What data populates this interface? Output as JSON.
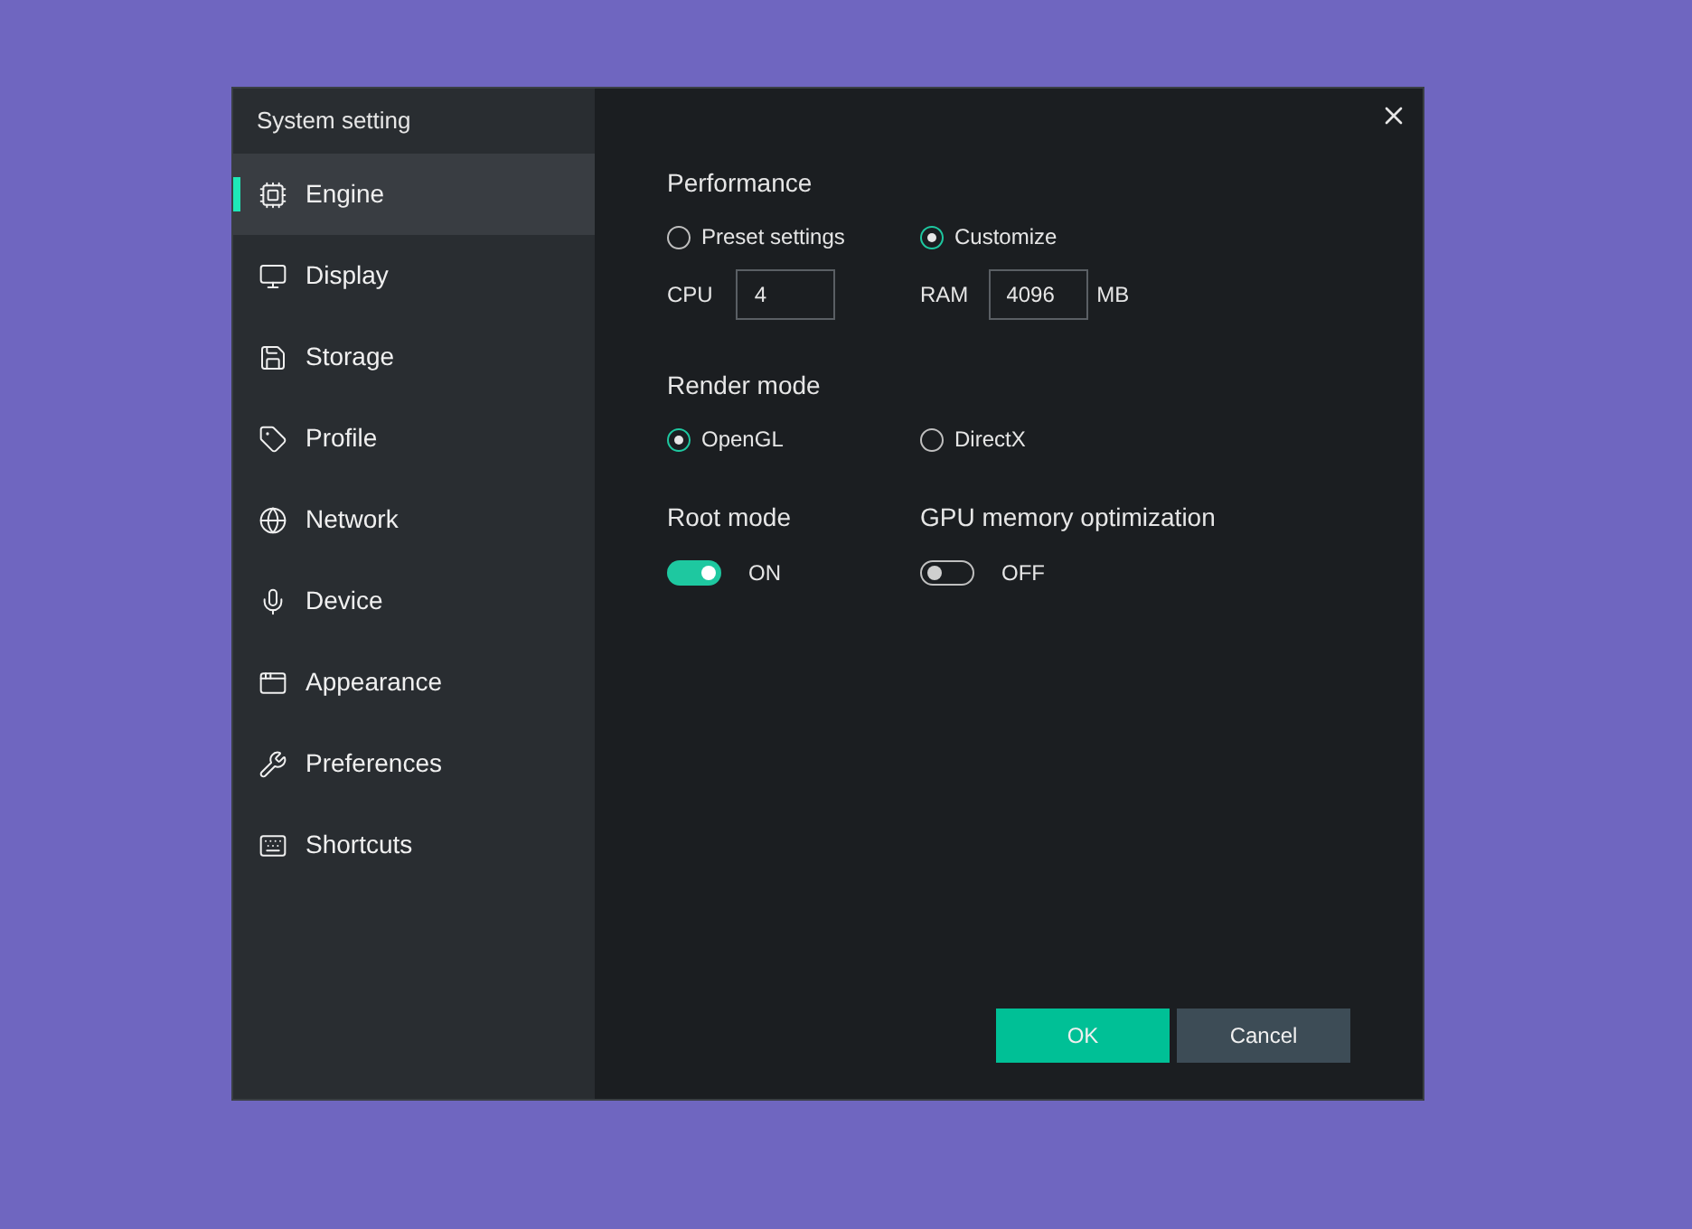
{
  "window": {
    "title": "System setting"
  },
  "sidebar": {
    "items": [
      {
        "label": "Engine",
        "selected": true
      },
      {
        "label": "Display",
        "selected": false
      },
      {
        "label": "Storage",
        "selected": false
      },
      {
        "label": "Profile",
        "selected": false
      },
      {
        "label": "Network",
        "selected": false
      },
      {
        "label": "Device",
        "selected": false
      },
      {
        "label": "Appearance",
        "selected": false
      },
      {
        "label": "Preferences",
        "selected": false
      },
      {
        "label": "Shortcuts",
        "selected": false
      }
    ]
  },
  "performance": {
    "title": "Performance",
    "options": [
      {
        "label": "Preset settings",
        "selected": false
      },
      {
        "label": "Customize",
        "selected": true
      }
    ],
    "cpu": {
      "label": "CPU",
      "value": "4"
    },
    "ram": {
      "label": "RAM",
      "value": "4096",
      "unit": "MB"
    }
  },
  "render_mode": {
    "title": "Render mode",
    "options": [
      {
        "label": "OpenGL",
        "selected": true
      },
      {
        "label": "DirectX",
        "selected": false
      }
    ]
  },
  "toggles": [
    {
      "title": "Root mode",
      "on": true,
      "state_label": "ON"
    },
    {
      "title": "GPU memory optimization",
      "on": false,
      "state_label": "OFF"
    }
  ],
  "buttons": [
    {
      "label": "OK",
      "kind": "primary"
    },
    {
      "label": "Cancel",
      "kind": "secondary"
    }
  ]
}
